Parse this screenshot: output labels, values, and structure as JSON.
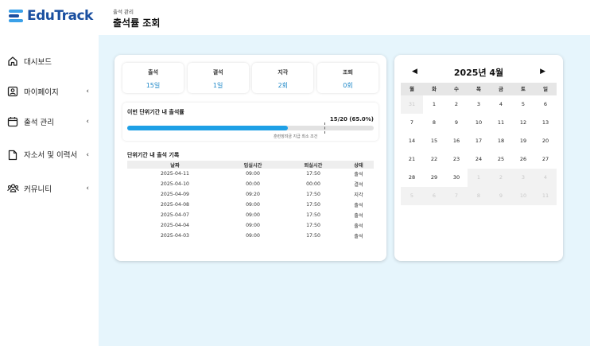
{
  "app": {
    "name": "EduTrack"
  },
  "sidebar": {
    "items": [
      {
        "label": "대시보드",
        "icon": "home-icon",
        "chevron": ""
      },
      {
        "label": "마이페이지",
        "icon": "user-card-icon",
        "chevron": "‹"
      },
      {
        "label": "출석 관리",
        "icon": "calendar-icon",
        "chevron": "‹"
      },
      {
        "label": "자소서 및 이력서",
        "icon": "document-icon",
        "chevron": "‹"
      },
      {
        "label": "커뮤니티",
        "icon": "community-icon",
        "chevron": "‹"
      }
    ]
  },
  "header": {
    "breadcrumb": "출석 관리",
    "title": "출석률 조회"
  },
  "stats": [
    {
      "label": "출석",
      "value": "15일"
    },
    {
      "label": "결석",
      "value": "1일"
    },
    {
      "label": "지각",
      "value": "2회"
    },
    {
      "label": "조퇴",
      "value": "0회"
    }
  ],
  "progress": {
    "title": "이번 단위기간 내 출석률",
    "value_text": "15/20 (65.0%)",
    "fill_fraction": 0.65,
    "threshold_fraction": 0.8,
    "note": "훈련장려금 지급 최소 조건"
  },
  "records": {
    "title": "단위기간 내 출석 기록",
    "headers": [
      "날짜",
      "입실시간",
      "퇴실시간",
      "상태"
    ],
    "rows": [
      [
        "2025-04-11",
        "09:00",
        "17:50",
        "출석",
        "present"
      ],
      [
        "2025-04-10",
        "00:00",
        "00:00",
        "결석",
        "absent"
      ],
      [
        "2025-04-09",
        "09:20",
        "17:50",
        "지각",
        "late"
      ],
      [
        "2025-04-08",
        "09:00",
        "17:50",
        "출석",
        "present"
      ],
      [
        "2025-04-07",
        "09:00",
        "17:50",
        "출석",
        "present"
      ],
      [
        "2025-04-04",
        "09:00",
        "17:50",
        "출석",
        "present"
      ],
      [
        "2025-04-03",
        "09:00",
        "17:50",
        "출석",
        "present"
      ]
    ]
  },
  "calendar": {
    "prev": "◀",
    "next": "▶",
    "title": "2025년 4월",
    "weekdays": [
      "월",
      "화",
      "수",
      "목",
      "금",
      "토",
      "일"
    ],
    "days": [
      {
        "d": "31",
        "other": true
      },
      {
        "d": "1"
      },
      {
        "d": "2"
      },
      {
        "d": "3"
      },
      {
        "d": "4"
      },
      {
        "d": "5"
      },
      {
        "d": "6"
      },
      {
        "d": "7"
      },
      {
        "d": "8"
      },
      {
        "d": "9"
      },
      {
        "d": "10"
      },
      {
        "d": "11"
      },
      {
        "d": "12"
      },
      {
        "d": "13"
      },
      {
        "d": "14"
      },
      {
        "d": "15"
      },
      {
        "d": "16"
      },
      {
        "d": "17"
      },
      {
        "d": "18"
      },
      {
        "d": "19"
      },
      {
        "d": "20"
      },
      {
        "d": "21"
      },
      {
        "d": "22"
      },
      {
        "d": "23"
      },
      {
        "d": "24"
      },
      {
        "d": "25"
      },
      {
        "d": "26"
      },
      {
        "d": "27"
      },
      {
        "d": "28"
      },
      {
        "d": "29"
      },
      {
        "d": "30"
      },
      {
        "d": "1",
        "other": true
      },
      {
        "d": "2",
        "other": true
      },
      {
        "d": "3",
        "other": true
      },
      {
        "d": "4",
        "other": true
      },
      {
        "d": "5",
        "other": true
      },
      {
        "d": "6",
        "other": true
      },
      {
        "d": "7",
        "other": true
      },
      {
        "d": "8",
        "other": true
      },
      {
        "d": "9",
        "other": true
      },
      {
        "d": "10",
        "other": true
      },
      {
        "d": "11",
        "other": true
      }
    ]
  },
  "colors": {
    "accent": "#1ea0e6",
    "present": "#2e9e3e",
    "absent": "#e23b3b",
    "late": "#f0a020",
    "background": "#e6f5fc"
  }
}
